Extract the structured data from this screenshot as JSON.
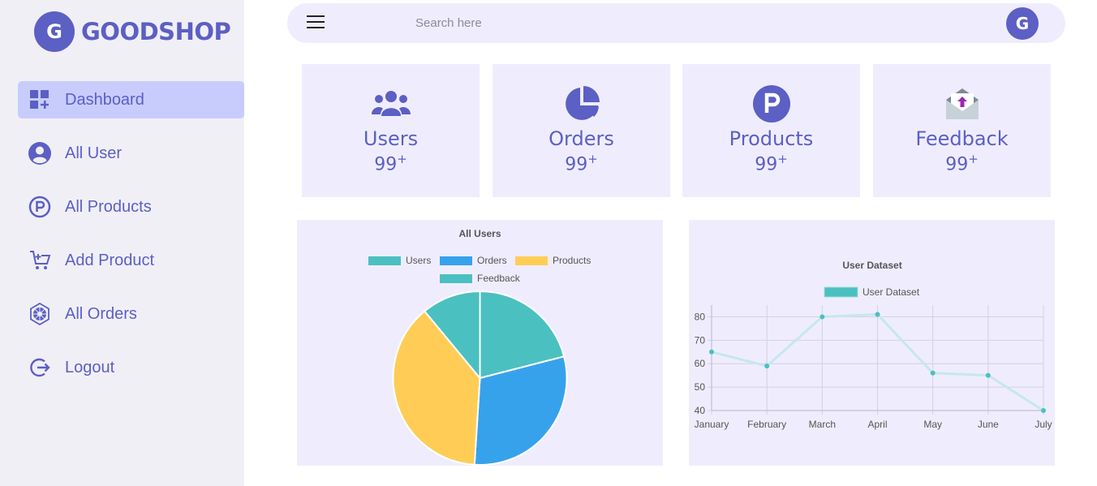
{
  "brand": {
    "logo_letter": "G",
    "name": "GOODSHOP"
  },
  "sidebar": {
    "items": [
      {
        "label": "Dashboard",
        "icon": "dashboard-icon",
        "active": true
      },
      {
        "label": "All User",
        "icon": "user-circle-icon"
      },
      {
        "label": "All Products",
        "icon": "product-p-icon"
      },
      {
        "label": "Add Product",
        "icon": "cart-add-icon"
      },
      {
        "label": "All Orders",
        "icon": "orders-emblem-icon"
      },
      {
        "label": "Logout",
        "icon": "logout-icon"
      }
    ]
  },
  "topbar": {
    "search_placeholder": "Search here",
    "avatar_letter": "G"
  },
  "cards": [
    {
      "title": "Users",
      "count": "99",
      "sup": "+",
      "icon": "users-group-icon"
    },
    {
      "title": "Orders",
      "count": "99",
      "sup": "+",
      "icon": "pie-chart-icon"
    },
    {
      "title": "Products",
      "count": "99",
      "sup": "+",
      "icon": "product-p-icon"
    },
    {
      "title": "Feedback",
      "count": "99",
      "sup": "+",
      "icon": "mail-upload-icon"
    }
  ],
  "colors": {
    "accent": "#5c5fc4",
    "active_nav": "#c8ccfc",
    "panel_bg": "#efedfd",
    "teal": "#4bc0c0",
    "blue": "#36a2eb",
    "yellow": "#ffcd56"
  },
  "chart_data": [
    {
      "type": "pie",
      "title": "All Users",
      "categories": [
        "Users",
        "Orders",
        "Products",
        "Feedback"
      ],
      "values": [
        21,
        30,
        38,
        11
      ],
      "colors": [
        "#4bc0c0",
        "#36a2eb",
        "#ffcd56",
        "#4bc0c0"
      ],
      "legend": "top"
    },
    {
      "type": "line",
      "title": "User Dataset",
      "categories": [
        "January",
        "February",
        "March",
        "April",
        "May",
        "June",
        "July"
      ],
      "series": [
        {
          "name": "User Dataset",
          "values": [
            65,
            59,
            80,
            81,
            56,
            55,
            40
          ]
        }
      ],
      "ylim": [
        40,
        85
      ],
      "yticks": [
        40,
        50,
        60,
        70,
        80
      ],
      "grid": true,
      "legend": "top"
    }
  ]
}
